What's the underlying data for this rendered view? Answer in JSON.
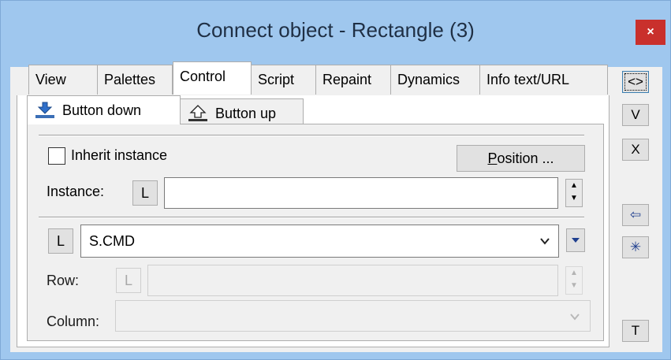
{
  "window": {
    "title": "Connect object - Rectangle (3)",
    "close_glyph": "×"
  },
  "tabs": [
    {
      "label": "View"
    },
    {
      "label": "Palettes"
    },
    {
      "label": "Control",
      "active": true
    },
    {
      "label": "Script"
    },
    {
      "label": "Repaint"
    },
    {
      "label": "Dynamics"
    },
    {
      "label": "Info text/URL"
    }
  ],
  "subtabs": [
    {
      "label": "Button down",
      "icon": "button-down-icon",
      "active": true
    },
    {
      "label": "Button up",
      "icon": "button-up-icon"
    }
  ],
  "panel": {
    "inherit_instance_label": "Inherit instance",
    "inherit_instance_checked": false,
    "position_button_label": "Position ...",
    "position_mnemonic": "P",
    "position_rest": "osition ...",
    "instance_label": "Instance:",
    "instance_l_label": "L",
    "instance_value": "",
    "command_l_label": "L",
    "command_value": "S.CMD",
    "row_label": "Row:",
    "row_l_label": "L",
    "row_value": "",
    "column_label": "Column:",
    "column_value": ""
  },
  "side_buttons": {
    "toggle": "<>",
    "v": "V",
    "x": "X",
    "arrow": "⇦",
    "star": "✳",
    "t": "T"
  },
  "colors": {
    "title_bar": "#9fc7ee",
    "close_button": "#c9302c",
    "dropdown_arrow": "#1f3f8f"
  }
}
